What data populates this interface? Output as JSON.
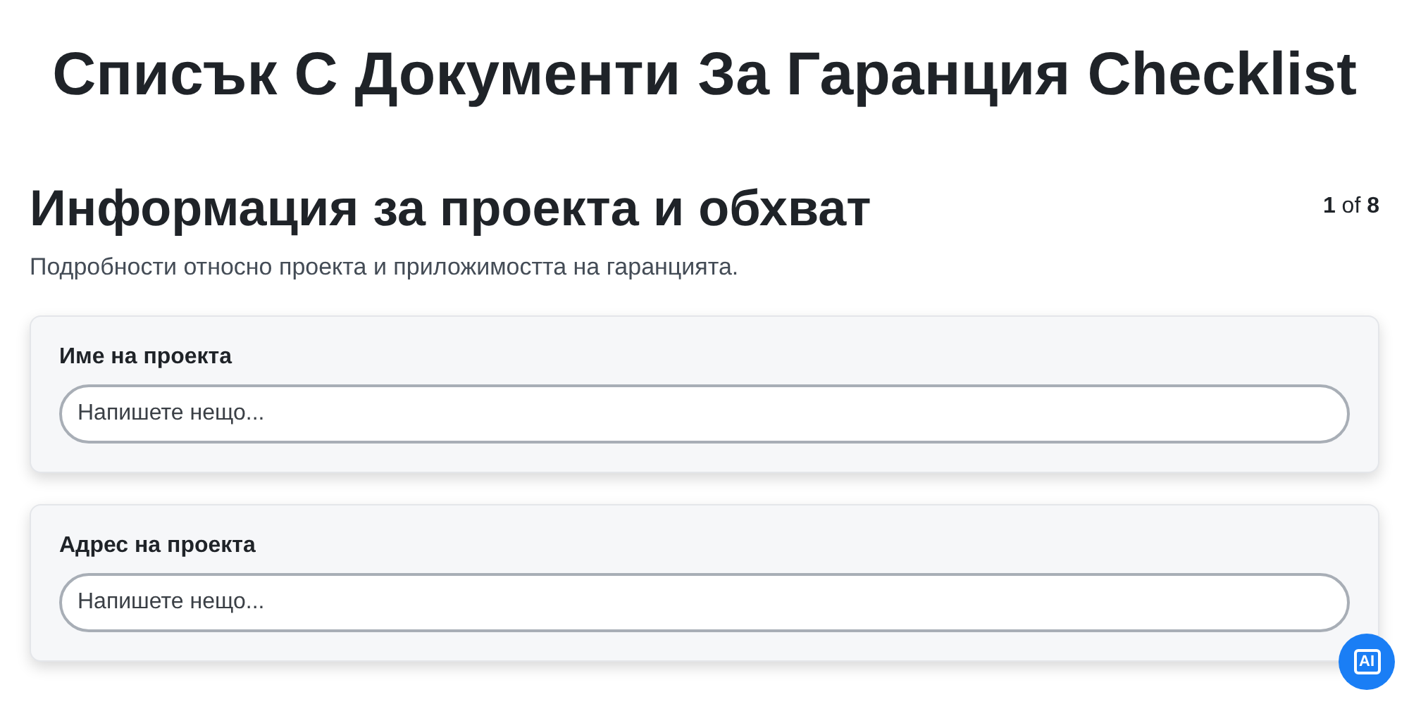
{
  "title": "Списък С Документи За Гаранция Checklist",
  "section": {
    "heading": "Информация за проекта и обхват",
    "page": "1",
    "of": "of",
    "total": "8",
    "description": "Подробности относно проекта и приложимостта на гаранцията."
  },
  "fields": [
    {
      "label": "Име на проекта",
      "placeholder": "Напишете нещо..."
    },
    {
      "label": "Адрес на проекта",
      "placeholder": "Напишете нещо..."
    }
  ],
  "ai_button": {
    "label": "AI"
  }
}
